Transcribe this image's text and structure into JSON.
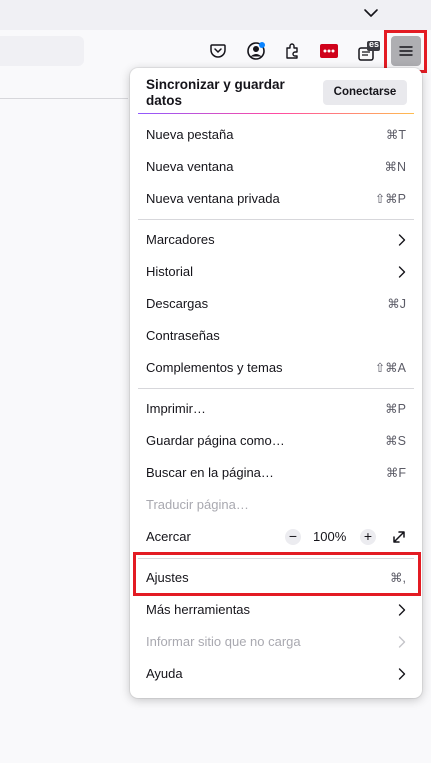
{
  "menu": {
    "sync": {
      "title": "Sincronizar y guardar datos",
      "button": "Conectarse"
    },
    "items": {
      "new_tab": {
        "label": "Nueva pestaña",
        "shortcut": "⌘T"
      },
      "new_window": {
        "label": "Nueva ventana",
        "shortcut": "⌘N"
      },
      "private_window": {
        "label": "Nueva ventana privada",
        "shortcut": "⇧⌘P"
      },
      "bookmarks": {
        "label": "Marcadores"
      },
      "history": {
        "label": "Historial"
      },
      "downloads": {
        "label": "Descargas",
        "shortcut": "⌘J"
      },
      "passwords": {
        "label": "Contraseñas"
      },
      "addons": {
        "label": "Complementos y temas",
        "shortcut": "⇧⌘A"
      },
      "print": {
        "label": "Imprimir…",
        "shortcut": "⌘P"
      },
      "save_page": {
        "label": "Guardar página como…",
        "shortcut": "⌘S"
      },
      "find": {
        "label": "Buscar en la página…",
        "shortcut": "⌘F"
      },
      "translate": {
        "label": "Traducir página…"
      },
      "zoom": {
        "label": "Acercar",
        "value": "100%",
        "minus": "−",
        "plus": "+"
      },
      "settings": {
        "label": "Ajustes",
        "shortcut": "⌘,"
      },
      "more_tools": {
        "label": "Más herramientas"
      },
      "report_site": {
        "label": "Informar sitio que no carga"
      },
      "help": {
        "label": "Ayuda"
      }
    }
  },
  "toolbar": {
    "language_badge": "es",
    "icons": [
      "pocket-icon",
      "account-icon",
      "extensions-icon",
      "password-manager-icon",
      "translate-icon",
      "hamburger-menu-icon"
    ]
  },
  "colors": {
    "highlight": "#e31b23",
    "accent_gradient": [
      "#9059ff",
      "#ff4aa2",
      "#ffbd4f"
    ]
  }
}
